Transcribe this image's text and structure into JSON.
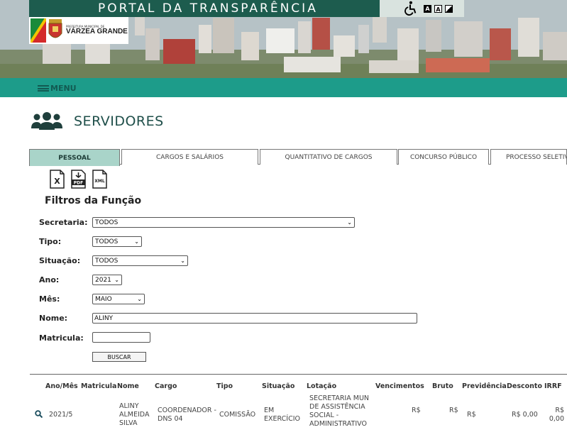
{
  "header": {
    "portal_title": "PORTAL DA TRANSPARÊNCIA",
    "logo_small": "PREFEITURA MUNICIPAL DE",
    "logo_city": "VÁRZEA GRANDE",
    "accessibility": {
      "wheelchair_icon": "wheelchair-icon",
      "contrast_a_dark": "A",
      "contrast_a_light": "A"
    }
  },
  "menu": {
    "label": "MENU"
  },
  "page": {
    "title": "SERVIDORES"
  },
  "tabs": [
    {
      "label": "PESSOAL"
    },
    {
      "label": "CARGOS E SALÁRIOS"
    },
    {
      "label": "QUANTITATIVO DE CARGOS"
    },
    {
      "label": "CONCURSO PÚBLICO"
    },
    {
      "label": "PROCESSO SELETIVO"
    }
  ],
  "exports": {
    "xls": "X",
    "pdf": "PDF",
    "xml": "XML"
  },
  "filters": {
    "title": "Filtros da Função",
    "secretaria": {
      "label": "Secretaria:",
      "value": "TODOS"
    },
    "tipo": {
      "label": "Tipo:",
      "value": "TODOS"
    },
    "situacao": {
      "label": "Situação:",
      "value": "TODOS"
    },
    "ano": {
      "label": "Ano:",
      "value": "2021"
    },
    "mes": {
      "label": "Mês:",
      "value": "MAIO"
    },
    "nome": {
      "label": "Nome:",
      "value": "ALINY"
    },
    "matricula": {
      "label": "Matricula:",
      "value": ""
    },
    "search_button": "BUSCAR"
  },
  "table": {
    "headers": {
      "ano_mes": "Ano/Mês",
      "matricula": "Matricula",
      "nome": "Nome",
      "cargo": "Cargo",
      "tipo": "Tipo",
      "situacao": "Situação",
      "lotacao": "Lotação",
      "vencimentos": "Vencimentos",
      "bruto": "Bruto",
      "previdencia": "Previdência",
      "desconto": "Desconto",
      "irrf": "IRRF"
    },
    "rows": [
      {
        "ano_mes": "2021/5",
        "matricula": "",
        "nome": "ALINY ALMEIDA SILVA",
        "cargo": "COORDENADOR - DNS 04",
        "tipo": "COMISSÃO",
        "situacao": "EM EXERCÍCIO",
        "lotacao": "SECRETARIA MUN DE ASSISTÊNCIA SOCIAL - ADMINISTRATIVO",
        "vencimentos": "R$",
        "bruto": "R$",
        "previdencia": "R$",
        "desconto": "R$ 0,00",
        "irrf": "R$ 0,00"
      }
    ]
  },
  "colors": {
    "header_green": "#1d5c4e",
    "menu_teal": "#1d9c8a",
    "tab_active": "#a9d4c9"
  }
}
